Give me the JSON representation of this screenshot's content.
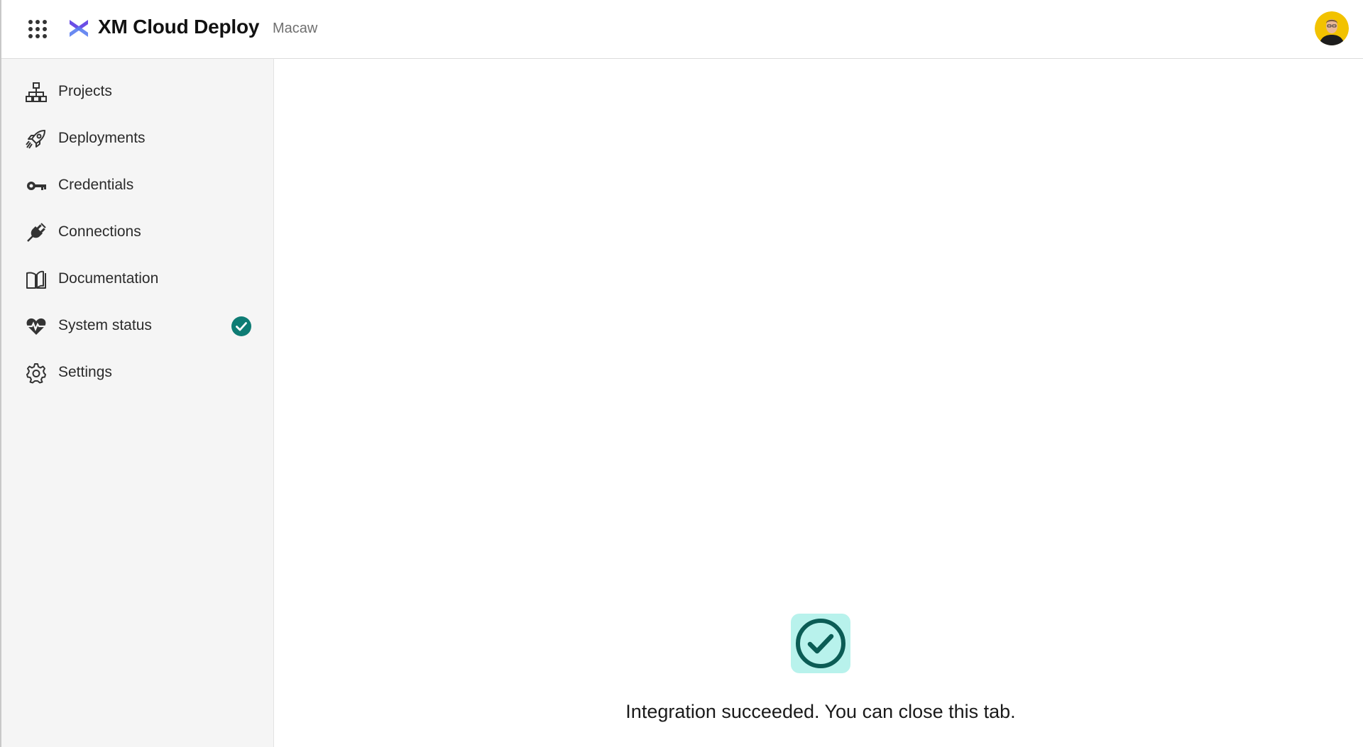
{
  "header": {
    "app_title": "XM Cloud Deploy",
    "tenant": "Macaw",
    "apps_icon": "apps-grid-icon",
    "logo_icon": "xm-cloud-logo",
    "avatar_icon": "user-avatar"
  },
  "sidebar": {
    "items": [
      {
        "label": "Projects",
        "icon": "sitemap-icon"
      },
      {
        "label": "Deployments",
        "icon": "rocket-icon"
      },
      {
        "label": "Credentials",
        "icon": "key-icon"
      },
      {
        "label": "Connections",
        "icon": "plug-icon"
      },
      {
        "label": "Documentation",
        "icon": "book-icon"
      },
      {
        "label": "System status",
        "icon": "heart-pulse-icon",
        "status_icon": "check-circle-icon"
      },
      {
        "label": "Settings",
        "icon": "gear-icon"
      }
    ]
  },
  "main": {
    "success_icon": "check-circle-icon",
    "message": "Integration succeeded. You can close this tab."
  },
  "colors": {
    "brand_logo": "#6B4EE6",
    "status_ok": "#0E7C74",
    "success_bg": "#B8F2EC",
    "success_fg": "#0B5C55",
    "sidebar_bg": "#F5F5F5"
  }
}
